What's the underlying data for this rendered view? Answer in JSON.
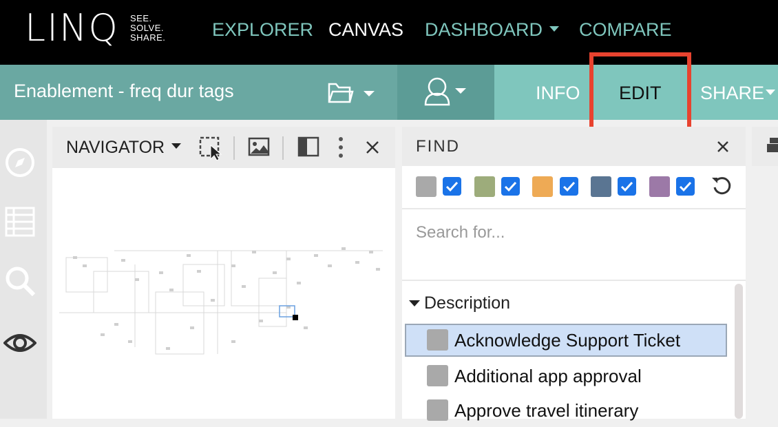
{
  "brand": {
    "word": "LINQ",
    "tagline_1": "SEE.",
    "tagline_2": "SOLVE.",
    "tagline_3": "SHARE."
  },
  "nav": {
    "explorer": "EXPLORER",
    "canvas": "CANVAS",
    "dashboard": "DASHBOARD",
    "compare": "COMPARE"
  },
  "toolbar": {
    "document_title": "Enablement - freq dur tags",
    "info": "INFO",
    "edit": "EDIT",
    "share": "SHARE"
  },
  "navigator": {
    "title": "NAVIGATOR"
  },
  "find": {
    "title": "FIND",
    "search_placeholder": "Search for...",
    "group_label": "Description",
    "color_filters": [
      "#a9a9a9",
      "#9dac7b",
      "#eeaa55",
      "#5a7592",
      "#9c79a7"
    ],
    "items": [
      "Acknowledge Support Ticket",
      "Additional app approval",
      "Approve travel itinerary"
    ],
    "selected_item": "Acknowledge Support Ticket"
  },
  "colors": {
    "topbar": "#000000",
    "accent_teal": "#7fc6bd",
    "highlight_red": "#e8432f",
    "checkbox_blue": "#1a73e8"
  },
  "icons": [
    "folder-icon",
    "user-icon",
    "compass-icon",
    "table-icon",
    "search-icon",
    "eye-icon",
    "select-region-icon",
    "image-icon",
    "panel-layout-icon",
    "more-icon",
    "close-icon",
    "reset-icon",
    "checkmark-icon"
  ]
}
